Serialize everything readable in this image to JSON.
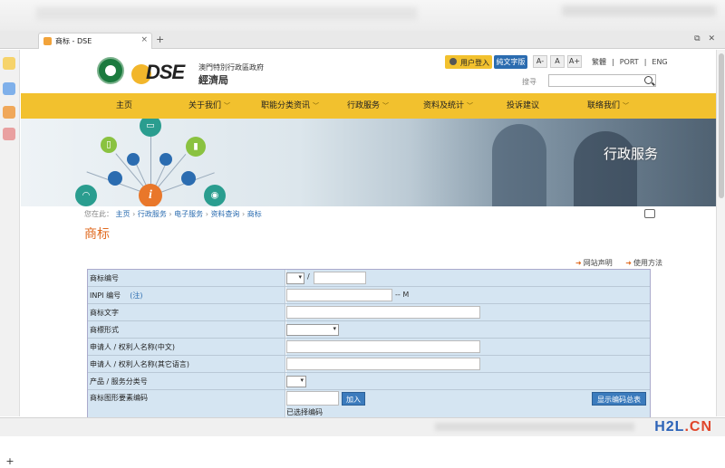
{
  "browser": {
    "tab_title": "商标 - DSE",
    "close_glyph": "×",
    "newtab_glyph": "+",
    "window_controls": "⧉ ✕",
    "bottom_plus": "+"
  },
  "header": {
    "org_line1": "澳門特別行政區政府",
    "org_line2": "經濟局",
    "logo_text": "DSE",
    "login_label": "用户登入",
    "text_version_label": "純文字版",
    "font_sizes": [
      "A-",
      "A",
      "A+"
    ],
    "languages": [
      "繁體",
      "PORT",
      "ENG"
    ],
    "lang_sep": "|",
    "search_label": "搜寻"
  },
  "nav": {
    "items": [
      {
        "label": "主页",
        "has_menu": false
      },
      {
        "label": "关于我们",
        "has_menu": true
      },
      {
        "label": "职能分类资讯",
        "has_menu": true
      },
      {
        "label": "行政服务",
        "has_menu": true
      },
      {
        "label": "资料及统计",
        "has_menu": true
      },
      {
        "label": "投诉建议",
        "has_menu": false
      },
      {
        "label": "联络我们",
        "has_menu": true
      }
    ],
    "chevron": "﹀"
  },
  "banner": {
    "title": "行政服务",
    "hub_glyph": "i"
  },
  "breadcrumb": {
    "prefix": "您在此：",
    "items": [
      "主页",
      "行政服务",
      "电子服务",
      "资料查询",
      "商标"
    ],
    "sep": "›"
  },
  "page_title": "商标",
  "links": {
    "disclaimer": "网站声明",
    "usage": "使用方法",
    "arrow": "➜"
  },
  "form": {
    "rows": [
      {
        "label": "商标编号",
        "slash": "/"
      },
      {
        "label": "INPI 编号",
        "note": "(注)",
        "suffix": "-- M"
      },
      {
        "label": "商标文字"
      },
      {
        "label": "商標形式"
      },
      {
        "label": "申请人 / 权利人名称(中文)"
      },
      {
        "label": "申请人 / 权利人名称(其它语言)"
      },
      {
        "label": "产品 / 服务分类号"
      },
      {
        "label": "商标图形要素编码",
        "add_button": "加入",
        "show_button": "显示编码总表",
        "selected_label": "已选择编码"
      }
    ]
  },
  "watermark": {
    "h2l": "H2L",
    "dot": ".",
    "cn": "CN"
  },
  "colors": {
    "nav_yellow": "#f2c12e",
    "title_orange": "#e06a1f",
    "link_blue": "#2b6cb0",
    "form_bg": "#d5e5f2"
  }
}
